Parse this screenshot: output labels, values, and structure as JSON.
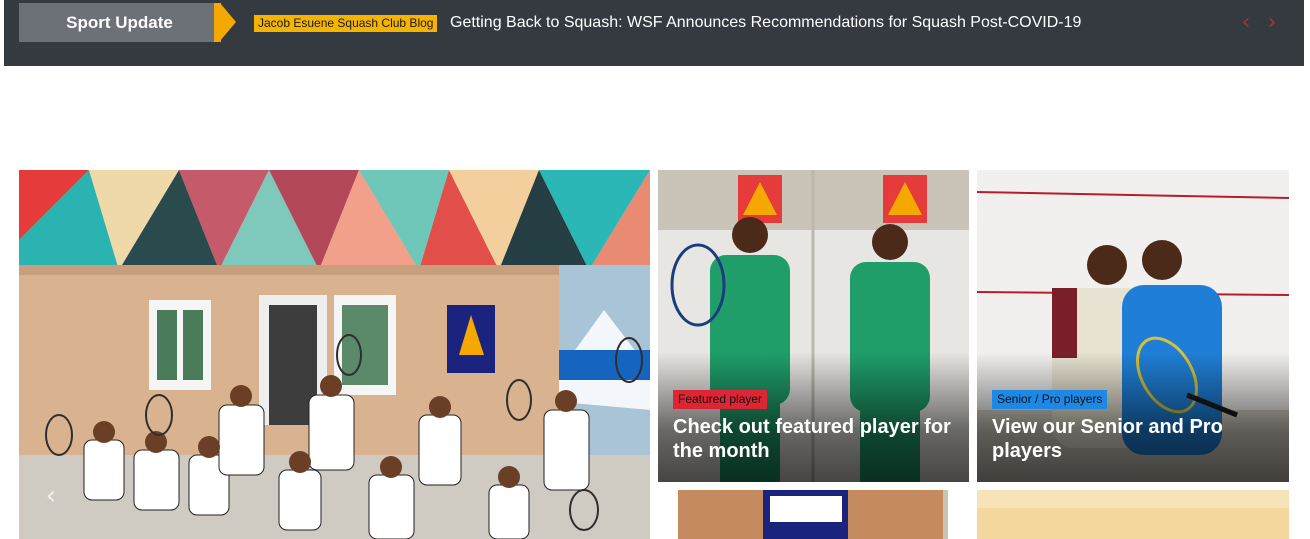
{
  "ticker": {
    "label": "Sport Update",
    "tag": "Jacob Esuene Squash Club Blog",
    "headline": "Getting Back to Squash: WSF Announces Recommendations for Squash Post-COVID-19",
    "prev_icon": "chevron-left-icon",
    "next_icon": "chevron-right-icon",
    "prev_glyph": "‹",
    "next_glyph": "›"
  },
  "hero": {
    "prev_icon": "chevron-left-icon",
    "prev_glyph": "‹"
  },
  "cards": [
    {
      "badge": "Featured player",
      "title": "Check out featured player for the month",
      "badge_color": "#dc2535"
    },
    {
      "badge": "Senior / Pro players",
      "title": "View our Senior and Pro players",
      "badge_color": "#1e88e5"
    }
  ],
  "colors": {
    "ticker_bg": "#343a40",
    "accent": "#f5a800",
    "tag_bg": "#f5b400"
  }
}
